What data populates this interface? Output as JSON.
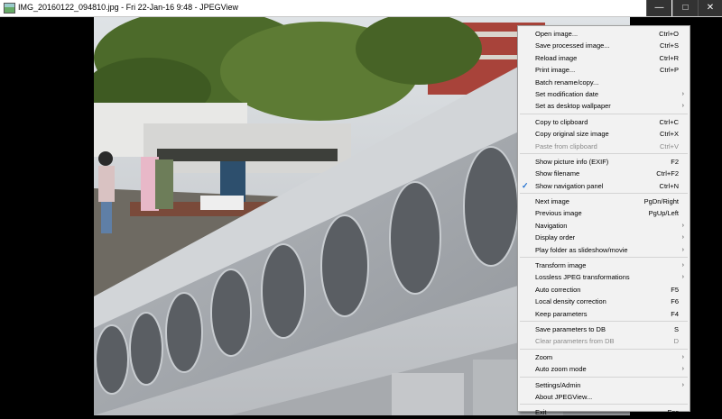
{
  "window": {
    "title": "IMG_20160122_094810.jpg - Fri 22-Jan-16 9:48 - JPEGView",
    "minimize_glyph": "—",
    "maximize_glyph": "□",
    "close_glyph": "✕"
  },
  "menu": {
    "groups": [
      [
        {
          "label": "Open image...",
          "shortcut": "Ctrl+O"
        },
        {
          "label": "Save processed image...",
          "shortcut": "Ctrl+S"
        },
        {
          "label": "Reload image",
          "shortcut": "Ctrl+R"
        },
        {
          "label": "Print image...",
          "shortcut": "Ctrl+P"
        },
        {
          "label": "Batch rename/copy...",
          "shortcut": ""
        },
        {
          "label": "Set modification date",
          "shortcut": "",
          "submenu": true
        },
        {
          "label": "Set as desktop wallpaper",
          "shortcut": "",
          "submenu": true
        }
      ],
      [
        {
          "label": "Copy to clipboard",
          "shortcut": "Ctrl+C"
        },
        {
          "label": "Copy original size image",
          "shortcut": "Ctrl+X"
        },
        {
          "label": "Paste from clipboard",
          "shortcut": "Ctrl+V",
          "disabled": true
        }
      ],
      [
        {
          "label": "Show picture info (EXIF)",
          "shortcut": "F2"
        },
        {
          "label": "Show filename",
          "shortcut": "Ctrl+F2"
        },
        {
          "label": "Show navigation panel",
          "shortcut": "Ctrl+N",
          "checked": true
        }
      ],
      [
        {
          "label": "Next image",
          "shortcut": "PgDn/Right"
        },
        {
          "label": "Previous image",
          "shortcut": "PgUp/Left"
        },
        {
          "label": "Navigation",
          "shortcut": "",
          "submenu": true
        },
        {
          "label": "Display order",
          "shortcut": "",
          "submenu": true
        },
        {
          "label": "Play folder as slideshow/movie",
          "shortcut": "",
          "submenu": true
        }
      ],
      [
        {
          "label": "Transform image",
          "shortcut": "",
          "submenu": true
        },
        {
          "label": "Lossless JPEG transformations",
          "shortcut": "",
          "submenu": true
        },
        {
          "label": "Auto correction",
          "shortcut": "F5"
        },
        {
          "label": "Local density correction",
          "shortcut": "F6"
        },
        {
          "label": "Keep parameters",
          "shortcut": "F4"
        }
      ],
      [
        {
          "label": "Save parameters to DB",
          "shortcut": "S"
        },
        {
          "label": "Clear parameters from DB",
          "shortcut": "D",
          "disabled": true
        }
      ],
      [
        {
          "label": "Zoom",
          "shortcut": "",
          "submenu": true
        },
        {
          "label": "Auto zoom mode",
          "shortcut": "",
          "submenu": true
        }
      ],
      [
        {
          "label": "Settings/Admin",
          "shortcut": "",
          "submenu": true
        },
        {
          "label": "About JPEGView...",
          "shortcut": ""
        }
      ],
      [
        {
          "label": "Exit",
          "shortcut": "Esc"
        }
      ]
    ],
    "submenu_glyph": "›",
    "check_glyph": "✓"
  },
  "colors": {
    "menu_bg": "#f2f2f2",
    "check_accent": "#1e6fd0",
    "title_bar_buttons": "#333333"
  }
}
